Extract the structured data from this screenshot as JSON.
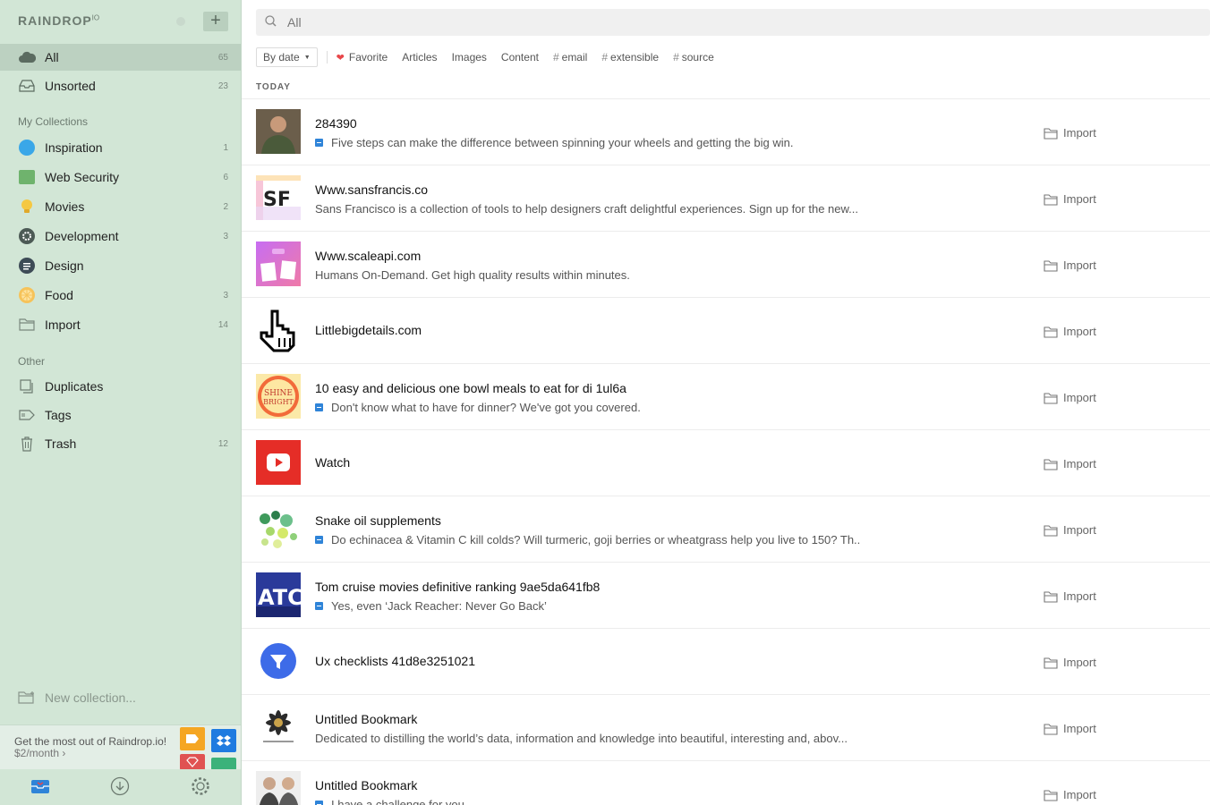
{
  "app": {
    "brand": "RAINDROP",
    "brand_suffix": "IO"
  },
  "sidebar": {
    "top_items": [
      {
        "label": "All",
        "count": "65",
        "icon": "cloud-icon"
      },
      {
        "label": "Unsorted",
        "count": "23",
        "icon": "inbox-icon"
      }
    ],
    "my_collections_title": "My Collections",
    "collections": [
      {
        "label": "Inspiration",
        "count": "1",
        "icon": "inspiration-icon",
        "color": "#3aa7e8"
      },
      {
        "label": "Web Security",
        "count": "6",
        "icon": "web-security-icon",
        "color": "#6fb36d"
      },
      {
        "label": "Movies",
        "count": "2",
        "icon": "lightbulb-icon",
        "color": "#f5c842"
      },
      {
        "label": "Development",
        "count": "3",
        "icon": "development-gear-icon",
        "color": "#4c5a55"
      },
      {
        "label": "Design",
        "count": "",
        "icon": "design-icon",
        "color": "#3d4b56"
      },
      {
        "label": "Food",
        "count": "3",
        "icon": "food-icon",
        "color": "#f6c35a"
      },
      {
        "label": "Import",
        "count": "14",
        "icon": "folder-icon",
        "color": "#8a978d"
      }
    ],
    "other_title": "Other",
    "other_items": [
      {
        "label": "Duplicates",
        "count": "",
        "icon": "duplicates-icon"
      },
      {
        "label": "Tags",
        "count": "",
        "icon": "tag-icon"
      },
      {
        "label": "Trash",
        "count": "12",
        "icon": "trash-icon"
      }
    ],
    "new_collection": "New collection...",
    "promo": {
      "text": "Get the most out of Raindrop.io!",
      "price": "$2/month"
    }
  },
  "search": {
    "placeholder": "All"
  },
  "filters": {
    "sort_label": "By date",
    "chips": [
      {
        "label": "Favorite",
        "type": "favorite"
      },
      {
        "label": "Articles",
        "type": "plain"
      },
      {
        "label": "Images",
        "type": "plain"
      },
      {
        "label": "Content",
        "type": "plain"
      },
      {
        "label": "email",
        "type": "tag"
      },
      {
        "label": "extensible",
        "type": "tag"
      },
      {
        "label": "source",
        "type": "tag"
      }
    ]
  },
  "section_label": "TODAY",
  "bookmarks": [
    {
      "title": "284390",
      "desc": "Five steps can make the difference between spinning your wheels and getting the big win.",
      "doc": true,
      "collection": "Import",
      "thumb": "person-photo"
    },
    {
      "title": "Www.sansfrancis.co",
      "desc": "Sans Francisco is a collection of tools to help designers craft delightful experiences. Sign up for the new...",
      "doc": false,
      "collection": "Import",
      "thumb": "sf-logo"
    },
    {
      "title": "Www.scaleapi.com",
      "desc": "Humans On-Demand. Get high quality results within minutes.",
      "doc": false,
      "collection": "Import",
      "thumb": "scale-logo"
    },
    {
      "title": "Littlebigdetails.com",
      "desc": "",
      "doc": false,
      "collection": "Import",
      "thumb": "pointer-hand"
    },
    {
      "title": "10 easy and delicious one bowl meals to eat for di 1ul6a",
      "desc": "Don't know what to have for dinner? We've got you covered.",
      "doc": true,
      "collection": "Import",
      "thumb": "shine-bright"
    },
    {
      "title": "Watch",
      "desc": "",
      "doc": false,
      "collection": "Import",
      "thumb": "youtube-logo"
    },
    {
      "title": "Snake oil supplements",
      "desc": "Do echinacea & Vitamin C kill colds? Will turmeric, goji berries or wheatgrass help you live to 150? Th..",
      "doc": true,
      "collection": "Import",
      "thumb": "dots-chart"
    },
    {
      "title": "Tom cruise movies definitive ranking 9ae5da641fb8",
      "desc": "Yes, even ‘Jack Reacher: Never Go Back’",
      "doc": true,
      "collection": "Import",
      "thumb": "atc-logo"
    },
    {
      "title": "Ux checklists 41d8e3251021",
      "desc": "",
      "doc": false,
      "collection": "Import",
      "thumb": "funnel-logo"
    },
    {
      "title": "Untitled Bookmark",
      "desc": "Dedicated to distilling the world’s data, information and knowledge into beautiful, interesting and, abov...",
      "doc": false,
      "collection": "Import",
      "thumb": "info-beautiful"
    },
    {
      "title": "Untitled Bookmark",
      "desc": "I have a challenge for you...",
      "doc": true,
      "collection": "Import",
      "thumb": "two-people"
    }
  ]
}
